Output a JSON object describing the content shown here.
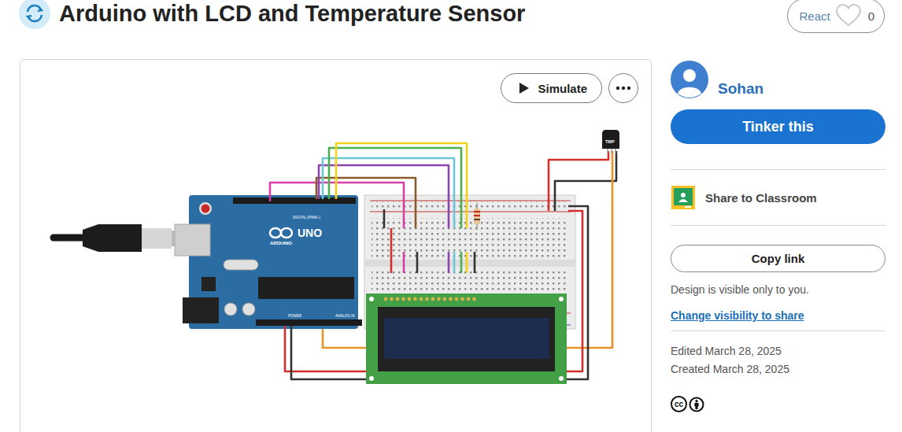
{
  "page": {
    "title": "Arduino with LCD and Temperature Sensor"
  },
  "reactions": {
    "label": "React",
    "count": "0"
  },
  "toolbar": {
    "simulate": "Simulate"
  },
  "circuit": {
    "board_model": "UNO",
    "board_brand": "ARDUINO",
    "digital_label": "DIGITAL (PWM~)",
    "power_label": "POWER",
    "analog_label": "ANALOG IN",
    "sensor_label": "TMP",
    "wires": [
      {
        "color": "#d63fa8"
      },
      {
        "color": "#8b5a2b"
      },
      {
        "color": "#8e44ad"
      },
      {
        "color": "#6cc7d8"
      },
      {
        "color": "#4caf50"
      },
      {
        "color": "#f1d21b"
      },
      {
        "color": "#d32f2f"
      },
      {
        "color": "#333333"
      },
      {
        "color": "#e8922a"
      },
      {
        "color": "#e8922a"
      },
      {
        "color": "#d32f2f"
      },
      {
        "color": "#333333"
      },
      {
        "color": "#d32f2f"
      },
      {
        "color": "#333333"
      },
      {
        "color": "#d63fa8"
      },
      {
        "color": "#333333"
      },
      {
        "color": "#8e44ad"
      },
      {
        "color": "#6cc7d8"
      },
      {
        "color": "#4caf50"
      },
      {
        "color": "#f1d21b"
      },
      {
        "color": "#333333"
      }
    ]
  },
  "sidebar": {
    "author": "Sohan",
    "primary_button": "Tinker this",
    "share": "Share to Classroom",
    "copy_button": "Copy link",
    "visibility_note": "Design is visible only to you.",
    "visibility_link": "Change visibility to share",
    "edited": "Edited March 28, 2025",
    "created": "Created March 28, 2025",
    "license_mark": "cc"
  }
}
